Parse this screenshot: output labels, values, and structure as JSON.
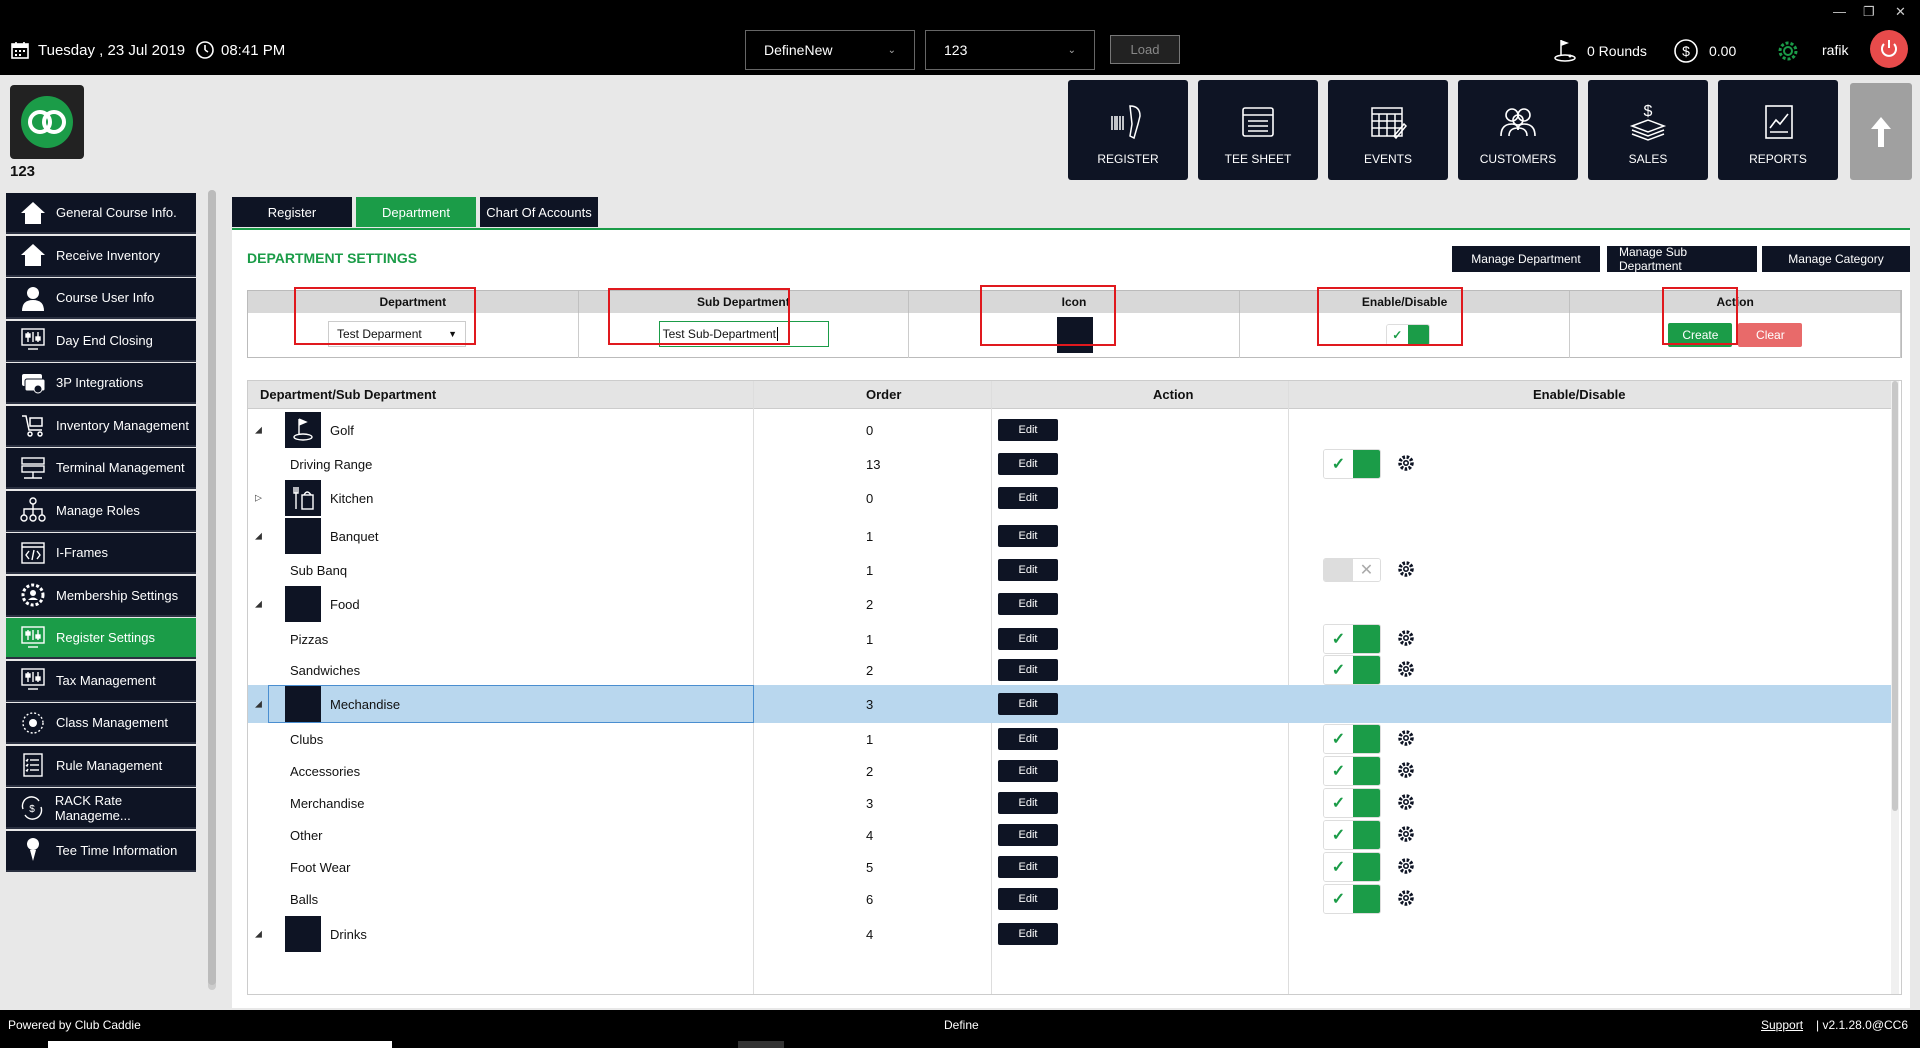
{
  "topbar": {
    "date": "Tuesday ,  23 Jul 2019",
    "time": "08:41 PM",
    "config_select": "DefineNew",
    "terminal_select": "123",
    "load_label": "Load",
    "rounds": "0 Rounds",
    "balance": "0.00",
    "username": "rafik"
  },
  "header": {
    "terminal_id": "123",
    "nav": [
      {
        "label": "REGISTER",
        "icon": "barcode-scanner-icon"
      },
      {
        "label": "TEE SHEET",
        "icon": "tee-sheet-icon"
      },
      {
        "label": "EVENTS",
        "icon": "calendar-icon"
      },
      {
        "label": "CUSTOMERS",
        "icon": "users-icon"
      },
      {
        "label": "SALES",
        "icon": "money-stack-icon"
      },
      {
        "label": "REPORTS",
        "icon": "report-chart-icon"
      }
    ]
  },
  "sidebar": {
    "items": [
      {
        "label": "General Course Info.",
        "icon": "home-icon",
        "active": false
      },
      {
        "label": "Receive Inventory",
        "icon": "home-icon",
        "active": false
      },
      {
        "label": "Course User Info",
        "icon": "user-icon",
        "active": false
      },
      {
        "label": "Day End Closing",
        "icon": "sliders-monitor-icon",
        "active": false
      },
      {
        "label": "3P Integrations",
        "icon": "cards-icon",
        "active": false
      },
      {
        "label": "Inventory Management",
        "icon": "cart-icon",
        "active": false
      },
      {
        "label": "Terminal Management",
        "icon": "server-icon",
        "active": false
      },
      {
        "label": "Manage Roles",
        "icon": "hierarchy-icon",
        "active": false
      },
      {
        "label": "I-Frames",
        "icon": "code-icon",
        "active": false
      },
      {
        "label": "Membership Settings",
        "icon": "gear-user-icon",
        "active": false
      },
      {
        "label": "Register Settings",
        "icon": "sliders-monitor-icon",
        "active": true
      },
      {
        "label": "Tax Management",
        "icon": "sliders-monitor-icon",
        "active": false
      },
      {
        "label": "Class Management",
        "icon": "class-gear-icon",
        "active": false
      },
      {
        "label": "Rule Management",
        "icon": "checklist-icon",
        "active": false
      },
      {
        "label": "RACK Rate Manageme...",
        "icon": "rate-icon",
        "active": false
      },
      {
        "label": "Tee Time Information",
        "icon": "tee-icon",
        "active": false
      }
    ]
  },
  "tabs": [
    {
      "label": "Register",
      "active": false
    },
    {
      "label": "Department",
      "active": true
    },
    {
      "label": "Chart Of Accounts",
      "active": false
    }
  ],
  "settings": {
    "title": "DEPARTMENT SETTINGS",
    "buttons": {
      "manage_department": "Manage Department",
      "manage_sub_department": "Manage Sub Department",
      "manage_category": "Manage Category"
    },
    "form": {
      "headers": [
        "Department",
        "Sub Department",
        "Icon",
        "Enable/Disable",
        "Action"
      ],
      "department_value": "Test Deparment",
      "sub_department_value": "Test Sub-Department",
      "create_label": "Create",
      "clear_label": "Clear"
    }
  },
  "grid": {
    "headers": {
      "name": "Department/Sub Department",
      "order": "Order",
      "action": "Action",
      "enable": "Enable/Disable"
    },
    "edit_label": "Edit",
    "rows": [
      {
        "name": "Golf",
        "order": "0",
        "level": 0,
        "expander": "◢",
        "icon": "golf-icon",
        "toggle": null
      },
      {
        "name": "Driving Range",
        "order": "13",
        "level": 1,
        "toggle": "on"
      },
      {
        "name": "Kitchen",
        "order": "0",
        "level": 0,
        "expander": "▷",
        "icon": "kitchen-icon",
        "toggle": null
      },
      {
        "name": "Banquet",
        "order": "1",
        "level": 0,
        "expander": "◢",
        "icon": "blank-icon",
        "toggle": null
      },
      {
        "name": "Sub Banq",
        "order": "1",
        "level": 1,
        "toggle": "off"
      },
      {
        "name": "Food",
        "order": "2",
        "level": 0,
        "expander": "◢",
        "icon": "blank-icon",
        "toggle": null
      },
      {
        "name": "Pizzas",
        "order": "1",
        "level": 1,
        "toggle": "on"
      },
      {
        "name": "Sandwiches",
        "order": "2",
        "level": 1,
        "toggle": "on"
      },
      {
        "name": "Mechandise",
        "order": "3",
        "level": 0,
        "expander": "◢",
        "icon": "blank-icon",
        "toggle": null,
        "selected": true
      },
      {
        "name": "Clubs",
        "order": "1",
        "level": 1,
        "toggle": "on"
      },
      {
        "name": "Accessories",
        "order": "2",
        "level": 1,
        "toggle": "on"
      },
      {
        "name": "Merchandise",
        "order": "3",
        "level": 1,
        "toggle": "on"
      },
      {
        "name": "Other",
        "order": "4",
        "level": 1,
        "toggle": "on"
      },
      {
        "name": "Foot Wear",
        "order": "5",
        "level": 1,
        "toggle": "on"
      },
      {
        "name": "Balls",
        "order": "6",
        "level": 1,
        "toggle": "on"
      },
      {
        "name": "Drinks",
        "order": "4",
        "level": 0,
        "expander": "◢",
        "icon": "blank-icon",
        "toggle": null
      }
    ]
  },
  "footer": {
    "powered_by": "Powered by Club Caddie",
    "center": "Define",
    "support": "Support",
    "version": "|    v2.1.28.0@CC6"
  },
  "colors": {
    "accent": "#1b9c48",
    "navy": "#0e1424",
    "danger": "#e0191e",
    "selected_row": "#b9d7ee"
  }
}
